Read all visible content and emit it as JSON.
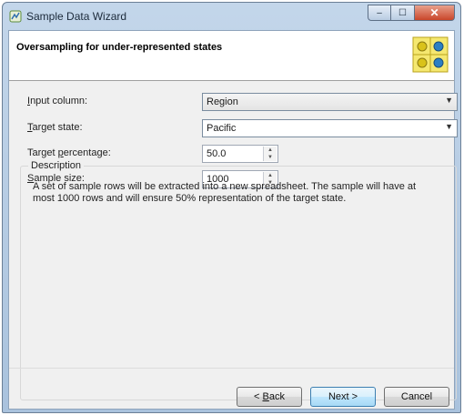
{
  "window": {
    "title": "Sample Data Wizard",
    "close_glyph": "✕",
    "max_glyph": "☐",
    "min_glyph": "–"
  },
  "header": {
    "title": "Oversampling for under-represented states"
  },
  "form": {
    "input_column": {
      "label_rest": "nput column:",
      "label_key": "I",
      "value": "Region",
      "arrow": "▼"
    },
    "target_state": {
      "label_rest": "arget state:",
      "label_key": "T",
      "value": "Pacific",
      "arrow": "▼"
    },
    "target_percentage": {
      "label_pre": "Target ",
      "label_key": "p",
      "label_rest": "ercentage:",
      "value": "50.0"
    },
    "sample_size": {
      "label_key": "S",
      "label_rest": "ample size:",
      "value": "1000"
    }
  },
  "description": {
    "title": "Description",
    "text": "A set of sample rows will be extracted into a new spreadsheet. The sample will have at most 1000 rows and will ensure 50% representation of the target state."
  },
  "buttons": {
    "back_pre": "< ",
    "back_key": "B",
    "back_rest": "ack",
    "next": "Next >",
    "cancel": "Cancel"
  },
  "spin": {
    "up": "▲",
    "down": "▼"
  },
  "colors": {
    "title_bar": "#b8cde4",
    "client_bg": "#f0f0f0",
    "accent": "#3c7fb1"
  }
}
